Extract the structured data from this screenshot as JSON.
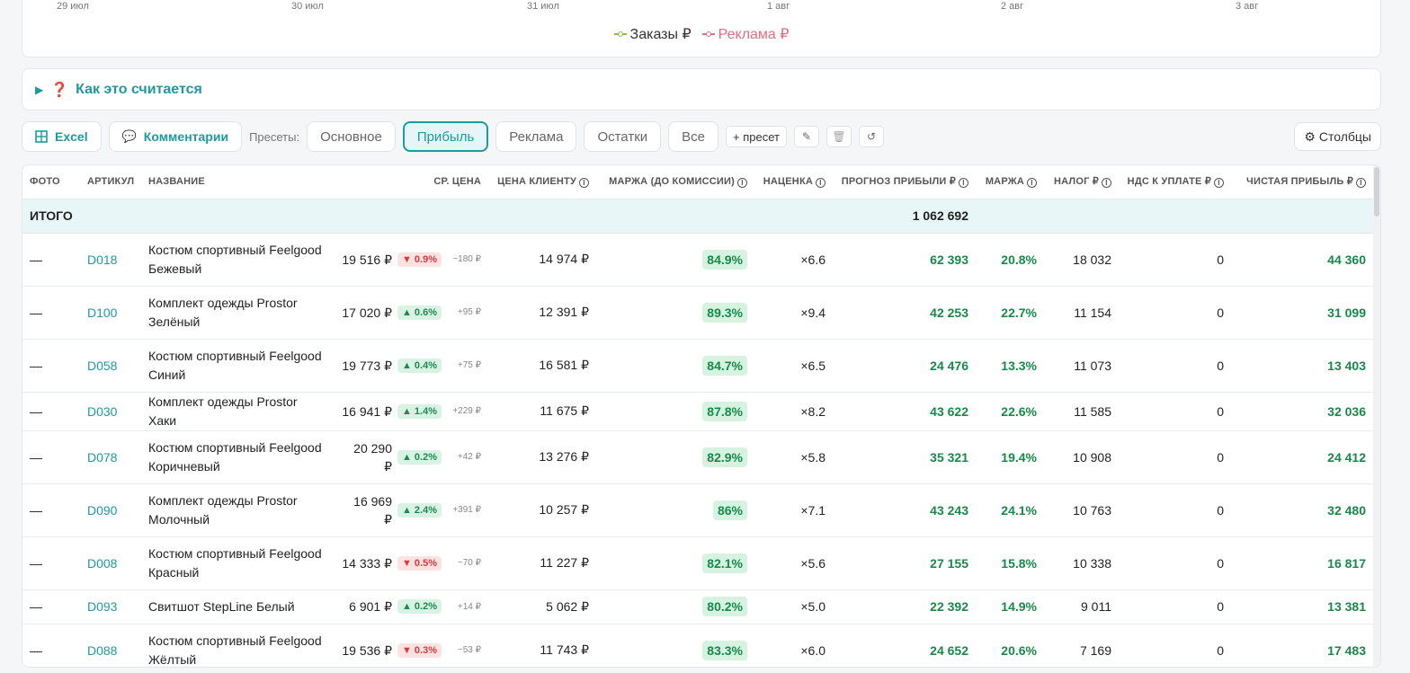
{
  "chart": {
    "xticks": [
      "29 июл",
      "30 июл",
      "31 июл",
      "1 авг",
      "2 авг",
      "3 авг"
    ],
    "legend": [
      {
        "label": "Заказы ₽",
        "color": "#8cbf3f"
      },
      {
        "label": "Реклама ₽",
        "color": "#e26d7f"
      }
    ]
  },
  "how": {
    "question_icon": "❓",
    "label": "Как это считается"
  },
  "toolbar": {
    "excel": "Excel",
    "comments": "Комментарии",
    "presets_label": "Пресеты:",
    "presets": [
      "Основное",
      "Прибыль",
      "Реклама",
      "Остатки",
      "Все"
    ],
    "active_preset": "Прибыль",
    "add_preset": "+ пресет",
    "edit_icon": "✎",
    "delete_icon": "🗑",
    "reset_icon": "↺",
    "columns": "Столбцы"
  },
  "table": {
    "headers": {
      "photo": "Фото",
      "sku": "Артикул",
      "name": "Название",
      "avg_price": "Ср. цена",
      "client_price": "Цена клиенту",
      "margin_pre": "Маржа (до комиссии)",
      "markup": "Наценка",
      "profit_forecast": "Прогноз прибыли ₽",
      "margin": "Маржа",
      "tax": "Налог ₽",
      "vat": "НДС к уплате ₽",
      "net_profit": "Чистая прибыль ₽"
    },
    "total": {
      "label": "ИТОГО",
      "profit_forecast": "1 062 692"
    },
    "rows": [
      {
        "photo": "—",
        "sku": "D018",
        "name": "Костюм спортивный Feelgood Бежевый",
        "price": "19 516 ₽",
        "dir": "down",
        "pct": "▼ 0.9%",
        "delta": "−180 ₽",
        "client": "14 974 ₽",
        "mpre": "84.9%",
        "markup": "×6.6",
        "profit": "62 393",
        "margin": "20.8%",
        "tax": "18 032",
        "vat": "0",
        "net": "44 360"
      },
      {
        "photo": "—",
        "sku": "D100",
        "name": "Комплект одежды Prostor Зелёный",
        "price": "17 020 ₽",
        "dir": "up",
        "pct": "▲ 0.6%",
        "delta": "+95 ₽",
        "client": "12 391 ₽",
        "mpre": "89.3%",
        "markup": "×9.4",
        "profit": "42 253",
        "margin": "22.7%",
        "tax": "11 154",
        "vat": "0",
        "net": "31 099"
      },
      {
        "photo": "—",
        "sku": "D058",
        "name": "Костюм спортивный Feelgood Синий",
        "price": "19 773 ₽",
        "dir": "up",
        "pct": "▲ 0.4%",
        "delta": "+75 ₽",
        "client": "16 581 ₽",
        "mpre": "84.7%",
        "markup": "×6.5",
        "profit": "24 476",
        "margin": "13.3%",
        "tax": "11 073",
        "vat": "0",
        "net": "13 403"
      },
      {
        "photo": "—",
        "sku": "D030",
        "name": "Комплект одежды Prostor Хаки",
        "price": "16 941 ₽",
        "dir": "up",
        "pct": "▲ 1.4%",
        "delta": "+229 ₽",
        "client": "11 675 ₽",
        "mpre": "87.8%",
        "markup": "×8.2",
        "profit": "43 622",
        "margin": "22.6%",
        "tax": "11 585",
        "vat": "0",
        "net": "32 036"
      },
      {
        "photo": "—",
        "sku": "D078",
        "name": "Костюм спортивный Feelgood Коричневый",
        "price": "20 290 ₽",
        "dir": "up",
        "pct": "▲ 0.2%",
        "delta": "+42 ₽",
        "client": "13 276 ₽",
        "mpre": "82.9%",
        "markup": "×5.8",
        "profit": "35 321",
        "margin": "19.4%",
        "tax": "10 908",
        "vat": "0",
        "net": "24 412"
      },
      {
        "photo": "—",
        "sku": "D090",
        "name": "Комплект одежды Prostor Молочный",
        "price": "16 969 ₽",
        "dir": "up",
        "pct": "▲ 2.4%",
        "delta": "+391 ₽",
        "client": "10 257 ₽",
        "mpre": "86%",
        "markup": "×7.1",
        "profit": "43 243",
        "margin": "24.1%",
        "tax": "10 763",
        "vat": "0",
        "net": "32 480"
      },
      {
        "photo": "—",
        "sku": "D008",
        "name": "Костюм спортивный Feelgood Красный",
        "price": "14 333 ₽",
        "dir": "down",
        "pct": "▼ 0.5%",
        "delta": "−70 ₽",
        "client": "11 227 ₽",
        "mpre": "82.1%",
        "markup": "×5.6",
        "profit": "27 155",
        "margin": "15.8%",
        "tax": "10 338",
        "vat": "0",
        "net": "16 817"
      },
      {
        "photo": "—",
        "sku": "D093",
        "name": "Свитшот StepLine Белый",
        "price": "6 901 ₽",
        "dir": "up",
        "pct": "▲ 0.2%",
        "delta": "+14 ₽",
        "client": "5 062 ₽",
        "mpre": "80.2%",
        "markup": "×5.0",
        "profit": "22 392",
        "margin": "14.9%",
        "tax": "9 011",
        "vat": "0",
        "net": "13 381"
      },
      {
        "photo": "—",
        "sku": "D088",
        "name": "Костюм спортивный Feelgood Жёлтый",
        "price": "19 536 ₽",
        "dir": "down",
        "pct": "▼ 0.3%",
        "delta": "−53 ₽",
        "client": "11 743 ₽",
        "mpre": "83.3%",
        "markup": "×6.0",
        "profit": "24 652",
        "margin": "20.6%",
        "tax": "7 169",
        "vat": "0",
        "net": "17 483"
      }
    ]
  }
}
